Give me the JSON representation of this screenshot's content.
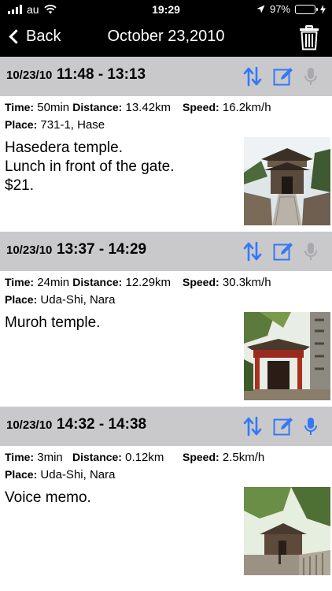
{
  "status_bar": {
    "carrier": "au",
    "time": "19:29",
    "battery_percent_label": "97%",
    "battery_level": 0.97,
    "battery_color": "#4cd964"
  },
  "nav": {
    "back_label": "Back",
    "title": "October 23,2010",
    "trash_icon": "trash-icon"
  },
  "accent_color": "#3478f6",
  "entries": [
    {
      "date": "10/23/10",
      "time_range": "11:48 - 13:13",
      "time_label": "Time:",
      "time_value": "50min",
      "distance_label": "Distance:",
      "distance_value": "13.42km",
      "speed_label": "Speed:",
      "speed_value": "16.2km/h",
      "place_label": "Place:",
      "place_value": "731-1, Hase",
      "memo": "Hasedera temple.\nLunch in front of the gate.\n$21.",
      "voice_memo": false,
      "photo": "temple-gate-photo"
    },
    {
      "date": "10/23/10",
      "time_range": "13:37 - 14:29",
      "time_label": "Time:",
      "time_value": "24min",
      "distance_label": "Distance:",
      "distance_value": "12.29km",
      "speed_label": "Speed:",
      "speed_value": "30.3km/h",
      "place_label": "Place:",
      "place_value": "Uda-Shi, Nara",
      "memo": "Muroh temple.",
      "voice_memo": false,
      "photo": "red-gate-photo"
    },
    {
      "date": "10/23/10",
      "time_range": "14:32 - 14:38",
      "time_label": "Time:",
      "time_value": "3min",
      "distance_label": "Distance:",
      "distance_value": "0.12km",
      "speed_label": "Speed:",
      "speed_value": "2.5km/h",
      "place_label": "Place:",
      "place_value": "Uda-Shi, Nara",
      "memo": "Voice memo.",
      "voice_memo": true,
      "photo": "forest-hall-photo"
    }
  ]
}
